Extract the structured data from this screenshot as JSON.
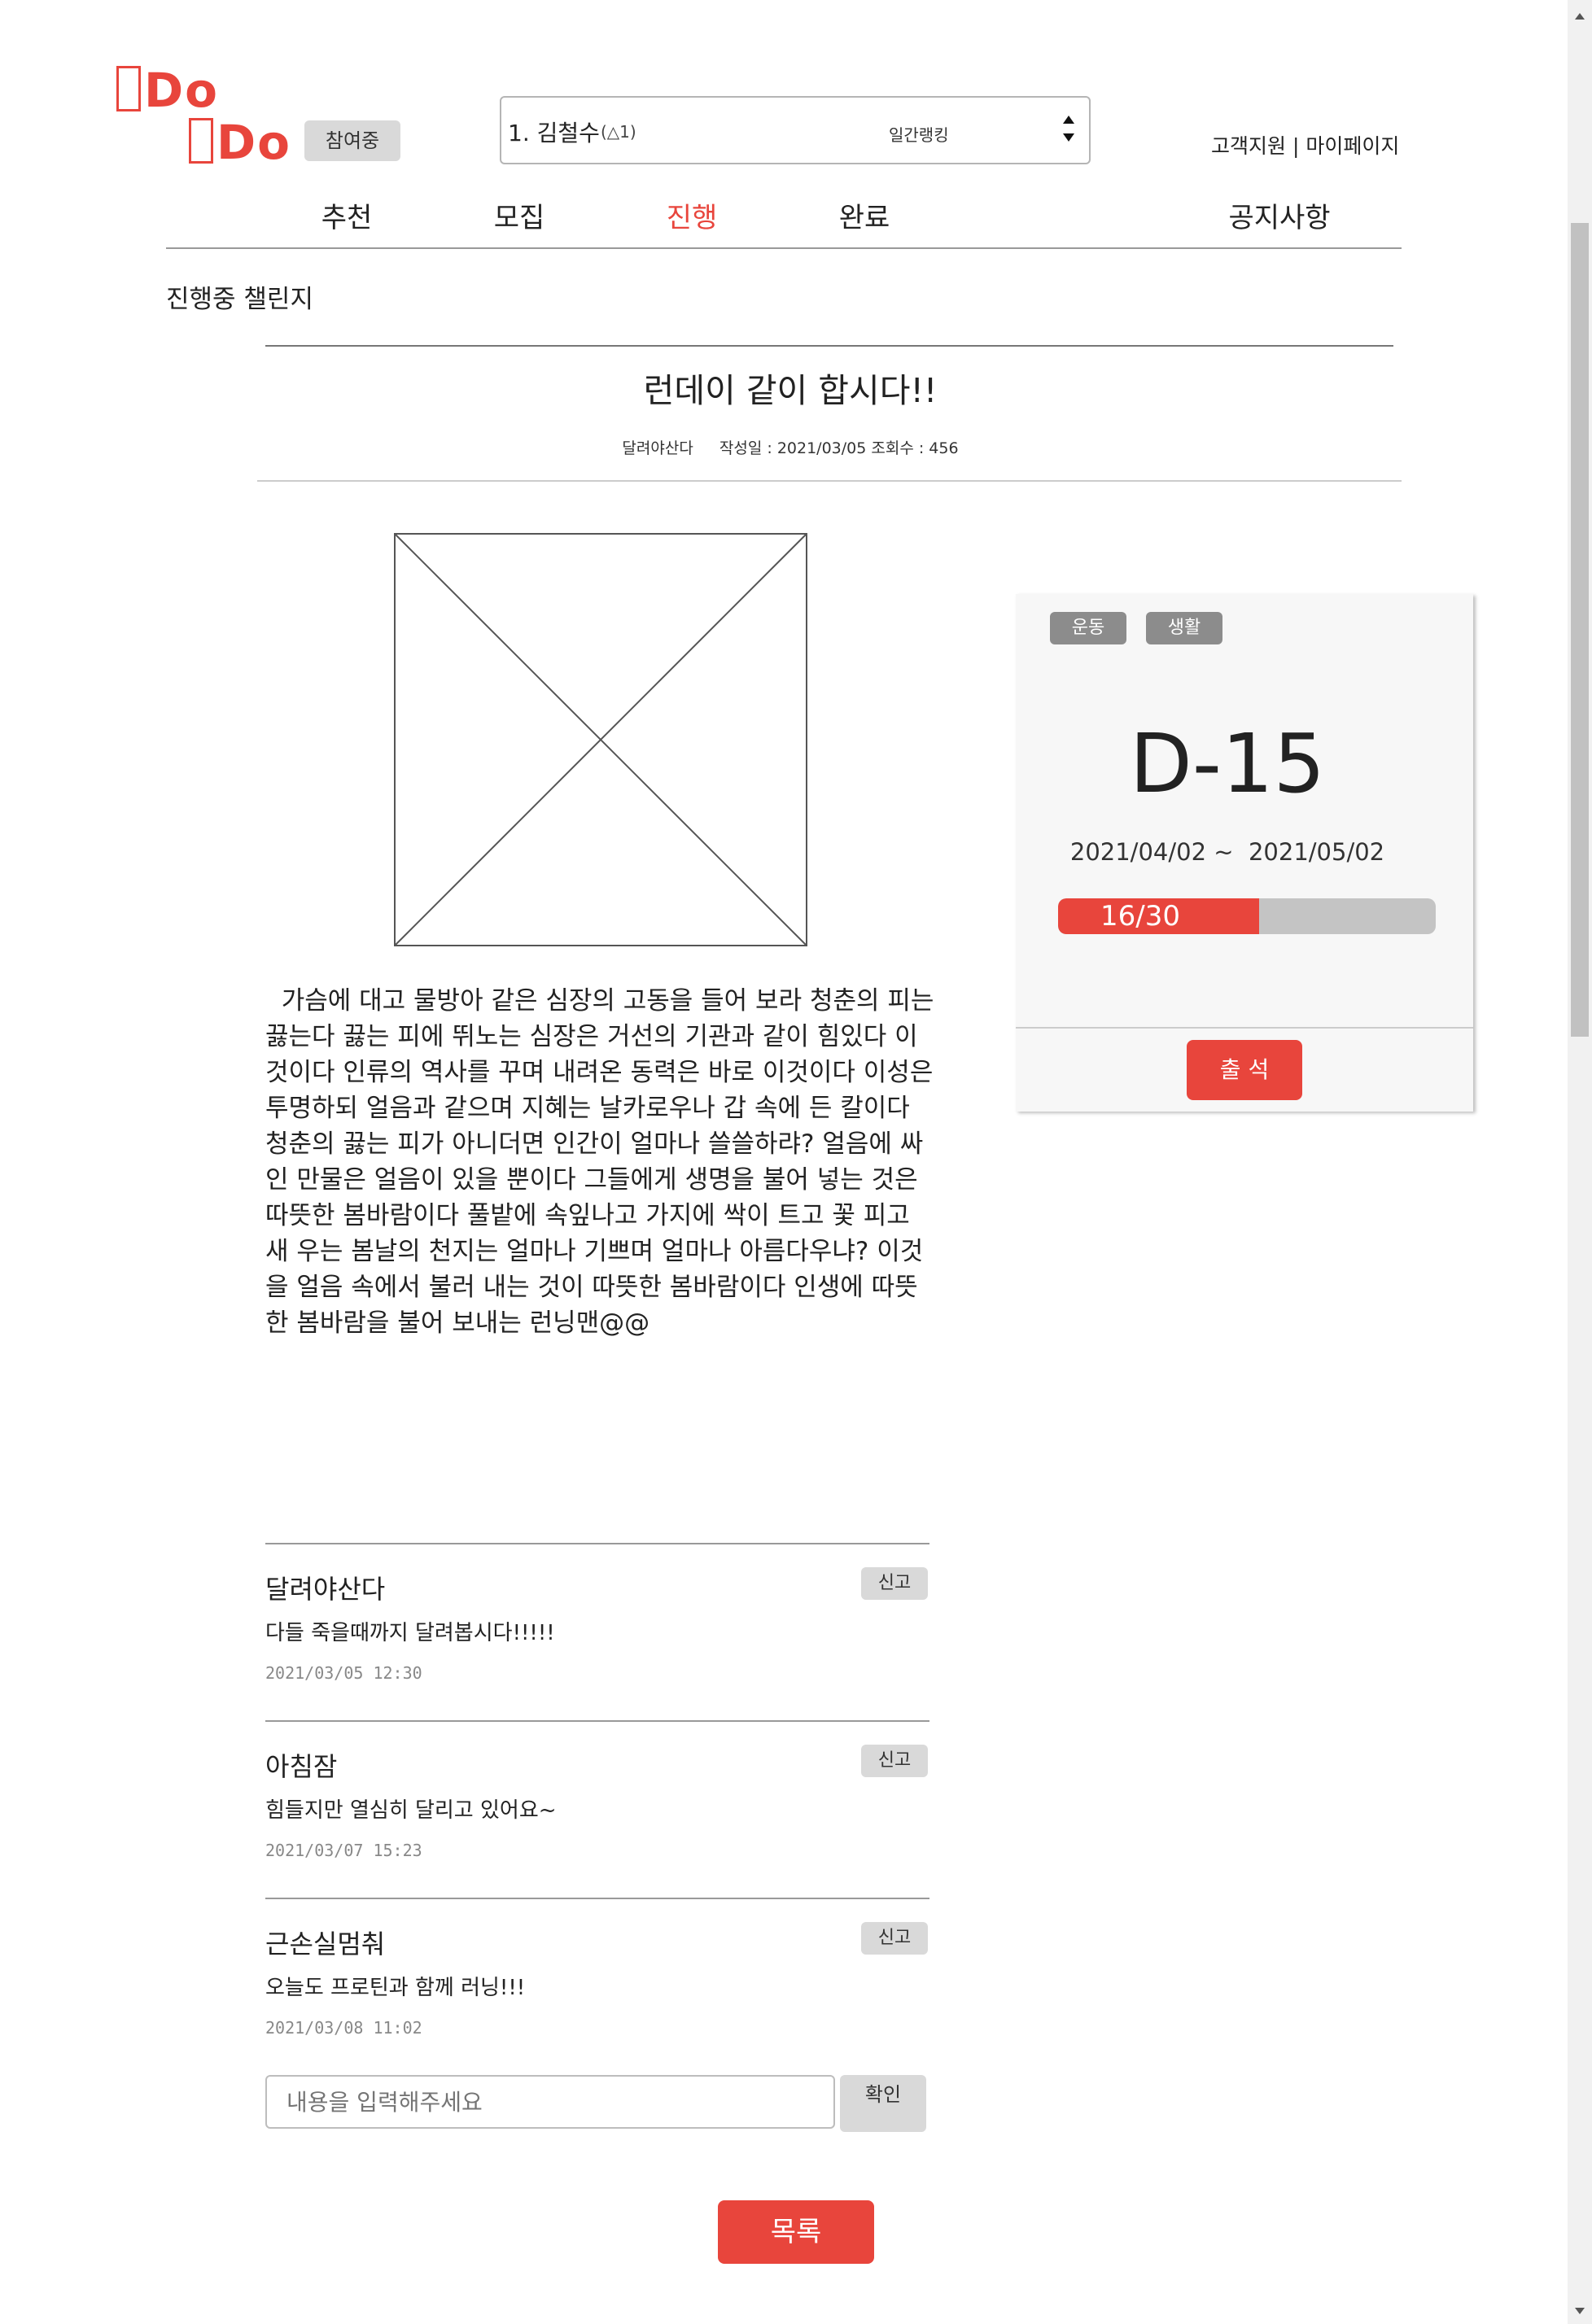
{
  "header": {
    "logo_line1": "Do",
    "logo_line2": "Do",
    "participating_badge": "참여중",
    "ranking_select": {
      "value": "1. 김철수",
      "sub": "(△1)",
      "label": "일간랭킹"
    },
    "support_link": "고객지원",
    "separator": "|",
    "mypage_link": "마이페이지"
  },
  "nav": {
    "tabs": [
      {
        "label": "추천"
      },
      {
        "label": "모집"
      },
      {
        "label": "진행"
      },
      {
        "label": "완료"
      }
    ],
    "notice": "공지사항",
    "active_tab": "진행"
  },
  "section_title": "진행중 챌린지",
  "post": {
    "title": "런데이 같이 합시다!!",
    "author": "달려야산다",
    "date_label": "작성일 : 2021/03/05",
    "views_label": "조회수 : 456",
    "body": "  가슴에 대고 물방아 같은 심장의 고동을 들어 보라 청춘의 피는 끓는다 끓는 피에 뛰노는 심장은 거선의 기관과 같이 힘있다 이것이다 인류의 역사를 꾸며 내려온 동력은 바로 이것이다 이성은 투명하되 얼음과 같으며 지혜는 날카로우나 갑 속에 든 칼이다 청춘의 끓는 피가 아니더면 인간이 얼마나 쓸쓸하랴? 얼음에 싸인 만물은 얼음이 있을 뿐이다 그들에게 생명을 불어 넣는 것은 따뜻한 봄바람이다 풀밭에 속잎나고 가지에 싹이 트고 꽃 피고 새 우는 봄날의 천지는 얼마나 기쁘며 얼마나 아름다우냐? 이것을 얼음 속에서 불러 내는 것이 따뜻한 봄바람이다 인생에 따뜻한 봄바람을 불어 보내는 런닝맨@@"
  },
  "challenge_card": {
    "tags": [
      "운동",
      "생활"
    ],
    "dday": "D-15",
    "period": "2021/04/02 ~  2021/05/02",
    "progress": {
      "label": "16/30",
      "current": 16,
      "total": 30
    },
    "attend_button": "출 석"
  },
  "comments": [
    {
      "author": "달려야산다",
      "text": "다들 죽을때까지 달려봅시다!!!!!",
      "date": "2021/03/05 12:30",
      "report": "신고"
    },
    {
      "author": "아침잠",
      "text": "힘들지만 열심히 달리고 있어요~",
      "date": "2021/03/07 15:23",
      "report": "신고"
    },
    {
      "author": "근손실멈춰",
      "text": "오늘도 프로틴과 함께 러닝!!!",
      "date": "2021/03/08 11:02",
      "report": "신고"
    }
  ],
  "comment_form": {
    "placeholder": "내용을 입력해주세요",
    "submit": "확인"
  },
  "list_button": "목록",
  "colors": {
    "accent": "#e8453c",
    "tag": "#8c8c8c",
    "progress_track": "#c4c4c4",
    "card_bg": "#f7f7f7"
  }
}
